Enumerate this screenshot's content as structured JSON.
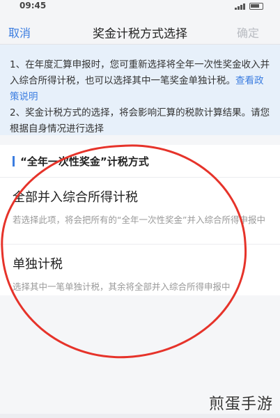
{
  "status_bar": {
    "time": "09:45"
  },
  "nav": {
    "cancel_label": "取消",
    "title": "奖金计税方式选择",
    "confirm_label": "确定"
  },
  "notice": {
    "line1": "1、在年度汇算申报时，您可重新选择将全年一次性奖金收入并入综合所得计税，也可以选择其中一笔奖金单独计税。",
    "link": "查看政策说明",
    "line2": "2、奖金计税方式的选择，将会影响汇算的税款计算结果。请您根据自身情况进行选择"
  },
  "section": {
    "title": "“全年一次性奖金”计税方式"
  },
  "options": [
    {
      "title": "全部并入综合所得计税",
      "desc": "若选择此项，将会把所有的“全年一次性奖金”并入综合所得申报中"
    },
    {
      "title": "单独计税",
      "desc": "选择其中一笔单独计税，其余将全部并入综合所得申报中"
    }
  ],
  "watermark": "煎蛋手游",
  "colors": {
    "accent": "#3b7de0",
    "annotation": "#e6332a",
    "notice_bg": "#e7f0fa"
  }
}
